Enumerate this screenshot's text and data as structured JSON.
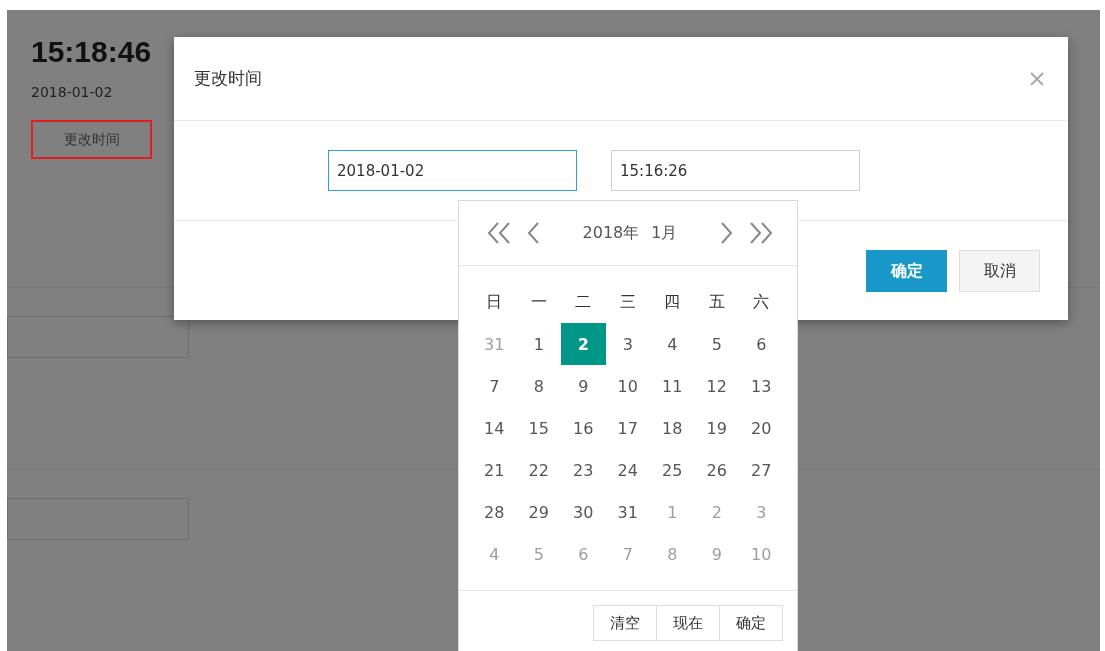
{
  "page": {
    "clock": "15:18:46",
    "date": "2018-01-02",
    "change_button": "更改时间"
  },
  "dialog": {
    "title": "更改时间",
    "date_value": "2018-01-02",
    "time_value": "15:16:26",
    "confirm": "确定",
    "cancel": "取消"
  },
  "calendar": {
    "year": "2018年",
    "month": "1月",
    "weekdays": [
      "日",
      "一",
      "二",
      "三",
      "四",
      "五",
      "六"
    ],
    "weeks": [
      [
        {
          "label": "31",
          "other_month": true,
          "selected": false
        },
        {
          "label": "1",
          "other_month": false,
          "selected": false
        },
        {
          "label": "2",
          "other_month": false,
          "selected": true
        },
        {
          "label": "3",
          "other_month": false,
          "selected": false
        },
        {
          "label": "4",
          "other_month": false,
          "selected": false
        },
        {
          "label": "5",
          "other_month": false,
          "selected": false
        },
        {
          "label": "6",
          "other_month": false,
          "selected": false
        }
      ],
      [
        {
          "label": "7",
          "other_month": false,
          "selected": false
        },
        {
          "label": "8",
          "other_month": false,
          "selected": false
        },
        {
          "label": "9",
          "other_month": false,
          "selected": false
        },
        {
          "label": "10",
          "other_month": false,
          "selected": false
        },
        {
          "label": "11",
          "other_month": false,
          "selected": false
        },
        {
          "label": "12",
          "other_month": false,
          "selected": false
        },
        {
          "label": "13",
          "other_month": false,
          "selected": false
        }
      ],
      [
        {
          "label": "14",
          "other_month": false,
          "selected": false
        },
        {
          "label": "15",
          "other_month": false,
          "selected": false
        },
        {
          "label": "16",
          "other_month": false,
          "selected": false
        },
        {
          "label": "17",
          "other_month": false,
          "selected": false
        },
        {
          "label": "18",
          "other_month": false,
          "selected": false
        },
        {
          "label": "19",
          "other_month": false,
          "selected": false
        },
        {
          "label": "20",
          "other_month": false,
          "selected": false
        }
      ],
      [
        {
          "label": "21",
          "other_month": false,
          "selected": false
        },
        {
          "label": "22",
          "other_month": false,
          "selected": false
        },
        {
          "label": "23",
          "other_month": false,
          "selected": false
        },
        {
          "label": "24",
          "other_month": false,
          "selected": false
        },
        {
          "label": "25",
          "other_month": false,
          "selected": false
        },
        {
          "label": "26",
          "other_month": false,
          "selected": false
        },
        {
          "label": "27",
          "other_month": false,
          "selected": false
        }
      ],
      [
        {
          "label": "28",
          "other_month": false,
          "selected": false
        },
        {
          "label": "29",
          "other_month": false,
          "selected": false
        },
        {
          "label": "30",
          "other_month": false,
          "selected": false
        },
        {
          "label": "31",
          "other_month": false,
          "selected": false
        },
        {
          "label": "1",
          "other_month": true,
          "selected": false
        },
        {
          "label": "2",
          "other_month": true,
          "selected": false
        },
        {
          "label": "3",
          "other_month": true,
          "selected": false
        }
      ],
      [
        {
          "label": "4",
          "other_month": true,
          "selected": false
        },
        {
          "label": "5",
          "other_month": true,
          "selected": false
        },
        {
          "label": "6",
          "other_month": true,
          "selected": false
        },
        {
          "label": "7",
          "other_month": true,
          "selected": false
        },
        {
          "label": "8",
          "other_month": true,
          "selected": false
        },
        {
          "label": "9",
          "other_month": true,
          "selected": false
        },
        {
          "label": "10",
          "other_month": true,
          "selected": false
        }
      ]
    ],
    "buttons": [
      "清空",
      "现在",
      "确定"
    ]
  }
}
